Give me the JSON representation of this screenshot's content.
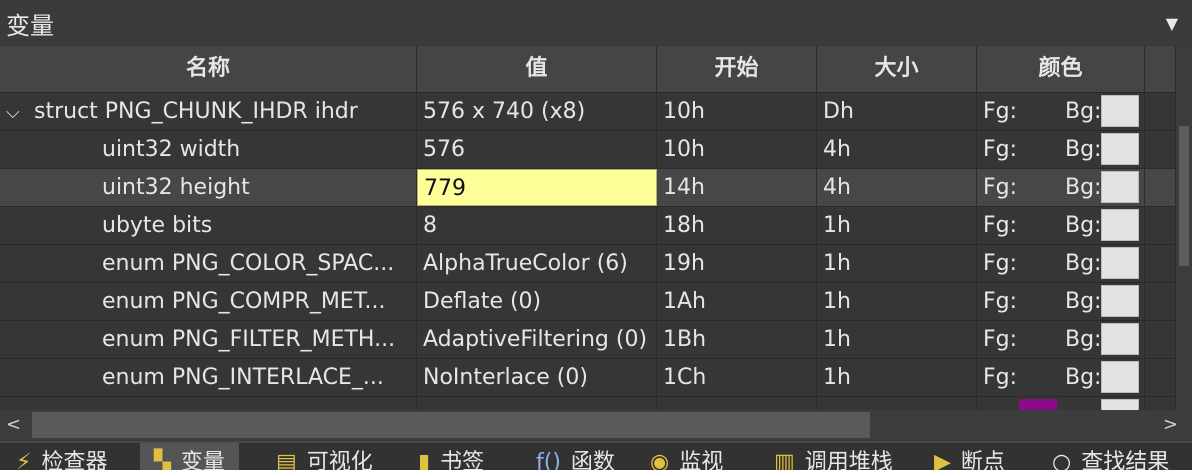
{
  "panel": {
    "title": "变量",
    "menu_icon": "dropdown-triangle-icon"
  },
  "columns": {
    "name": "名称",
    "value": "值",
    "start": "开始",
    "size": "大小",
    "color": "颜色"
  },
  "rows": [
    {
      "name": "struct PNG_CHUNK_IHDR ihdr",
      "value": "576 x 740 (x8)",
      "start": "10h",
      "size": "Dh",
      "fg": "Fg:",
      "bg": "Bg:",
      "expanded": true
    },
    {
      "name": "uint32 width",
      "value": "576",
      "start": "10h",
      "size": "4h",
      "fg": "Fg:",
      "bg": "Bg:"
    },
    {
      "name": "uint32 height",
      "value": "779",
      "start": "14h",
      "size": "4h",
      "fg": "Fg:",
      "bg": "Bg:",
      "selected": true
    },
    {
      "name": "ubyte bits",
      "value": "8",
      "start": "18h",
      "size": "1h",
      "fg": "Fg:",
      "bg": "Bg:"
    },
    {
      "name": "enum PNG_COLOR_SPAC...",
      "value": "AlphaTrueColor (6)",
      "start": "19h",
      "size": "1h",
      "fg": "Fg:",
      "bg": "Bg:"
    },
    {
      "name": "enum PNG_COMPR_MET...",
      "value": "Deflate (0)",
      "start": "1Ah",
      "size": "1h",
      "fg": "Fg:",
      "bg": "Bg:"
    },
    {
      "name": "enum PNG_FILTER_METH...",
      "value": "AdaptiveFiltering (0)",
      "start": "1Bh",
      "size": "1h",
      "fg": "Fg:",
      "bg": "Bg:"
    },
    {
      "name": "enum PNG_INTERLACE_...",
      "value": "NoInterlace (0)",
      "start": "1Ch",
      "size": "1h",
      "fg": "Fg:",
      "bg": "Bg:"
    }
  ],
  "tabs": [
    {
      "label": "检查器",
      "icon": "lightning-icon"
    },
    {
      "label": "变量",
      "icon": "variables-icon",
      "active": true
    },
    {
      "label": "可视化",
      "icon": "document-icon"
    },
    {
      "label": "书签",
      "icon": "bookmark-icon"
    },
    {
      "label": "函数",
      "icon": "function-icon"
    },
    {
      "label": "监视",
      "icon": "eye-icon"
    },
    {
      "label": "调用堆栈",
      "icon": "stack-icon"
    },
    {
      "label": "断点",
      "icon": "breakpoint-icon"
    },
    {
      "label": "查找结果",
      "icon": "search-icon"
    }
  ],
  "colors": {
    "highlight_value": "#ffff99",
    "fg_swatch_purple": "#8a0a8a",
    "bg_swatch": "#e3e3e3"
  }
}
